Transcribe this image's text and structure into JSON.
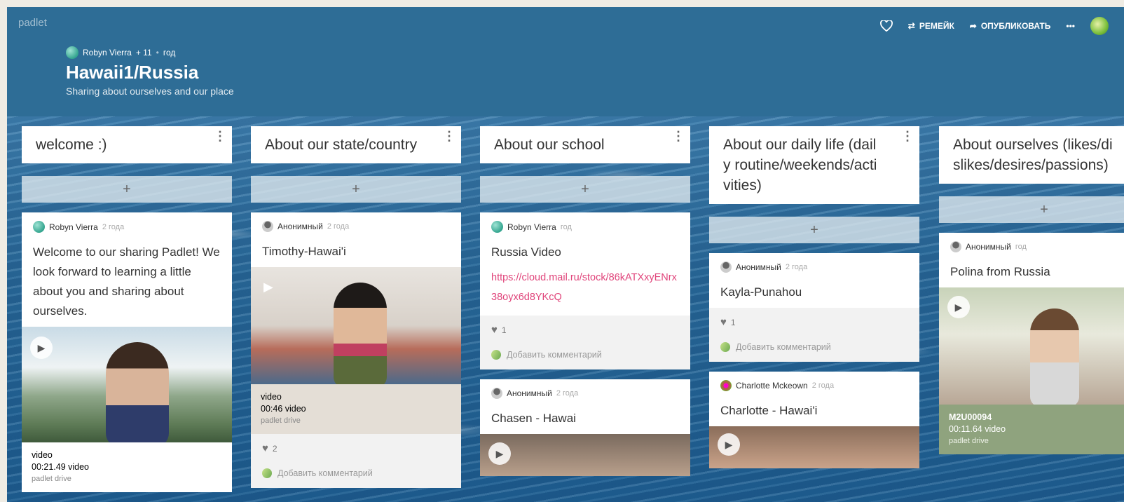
{
  "header": {
    "logo": "padlet",
    "remake": "РЕМЕЙК",
    "publish": "ОПУБЛИКОВАТЬ",
    "more": "•••",
    "author": "Robyn Vierra",
    "contributors": "+ 11",
    "dot": "•",
    "age": "год",
    "title": "Hawaii1/Russia",
    "subtitle": "Sharing about ourselves and our place"
  },
  "columns": [
    {
      "title": "welcome :)",
      "add": "+",
      "card": {
        "author": "Robyn Vierra",
        "time": "2 года",
        "title": "Welcome to our sharing Padlet! We look forward to learning a little about you and sharing about ourselves.",
        "media_type": "video",
        "duration": "00:21.49 video",
        "source": "padlet drive"
      }
    },
    {
      "title": "About our state/country",
      "add": "+",
      "card": {
        "author": "Анонимный",
        "time": "2 года",
        "title": "Timothy-Hawai'i",
        "media_type": "video",
        "duration": "00:46 video",
        "source": "padlet drive",
        "likes": "2",
        "comment": "Добавить комментарий"
      }
    },
    {
      "title": "About our school",
      "add": "+",
      "card": {
        "author": "Robyn Vierra",
        "time": "год",
        "title": "Russia Video",
        "link": "https://cloud.mail.ru/stock/86kATXxyENrx38oyx6d8YKcQ",
        "likes": "1",
        "comment": "Добавить комментарий"
      },
      "card2": {
        "author": "Анонимный",
        "time": "2 года",
        "title": "Chasen - Hawai"
      }
    },
    {
      "title": "About our daily life (daily routine/weekends/activities)",
      "add": "+",
      "card": {
        "author": "Анонимный",
        "time": "2 года",
        "title": "Kayla-Punahou",
        "likes": "1",
        "comment": "Добавить комментарий"
      },
      "card2": {
        "author": "Charlotte Mckeown",
        "time": "2 года",
        "title": "Charlotte - Hawai'i"
      }
    },
    {
      "title": "About ourselves (likes/dislikes/desires/passions)",
      "add": "+",
      "card": {
        "author": "Анонимный",
        "time": "год",
        "title": "Polina from Russia",
        "media_type": "M2U00094",
        "duration": "00:11.64 video",
        "source": "padlet drive"
      }
    }
  ]
}
